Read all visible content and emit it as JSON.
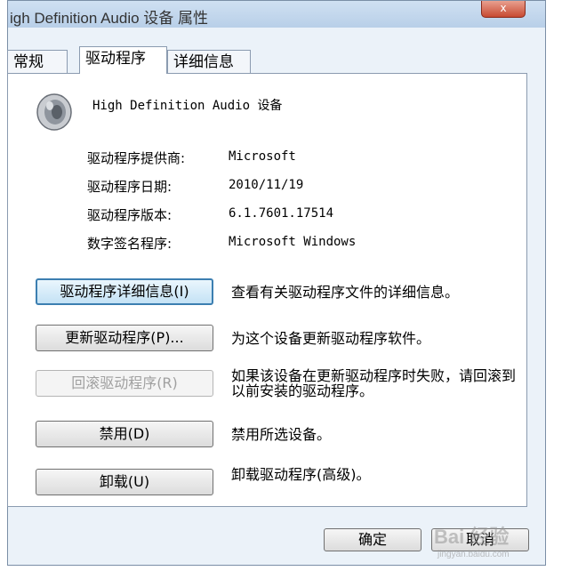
{
  "window": {
    "title": "igh Definition Audio 设备 属性",
    "close_label": "x"
  },
  "tabs": [
    {
      "label": "常规"
    },
    {
      "label": "驱动程序"
    },
    {
      "label": "详细信息"
    }
  ],
  "device": {
    "name": "High Definition Audio 设备",
    "icon": "speaker-icon"
  },
  "info": [
    {
      "label": "驱动程序提供商:",
      "value": "Microsoft"
    },
    {
      "label": "驱动程序日期:",
      "value": "2010/11/19"
    },
    {
      "label": "驱动程序版本:",
      "value": "6.1.7601.17514"
    },
    {
      "label": "数字签名程序:",
      "value": "Microsoft Windows"
    }
  ],
  "actions": [
    {
      "button": "驱动程序详细信息(I)",
      "description": "查看有关驱动程序文件的详细信息。"
    },
    {
      "button": "更新驱动程序(P)...",
      "description": "为这个设备更新驱动程序软件。"
    },
    {
      "button": "回滚驱动程序(R)",
      "description": "如果该设备在更新驱动程序时失败，请回滚到以前安装的驱动程序。"
    },
    {
      "button": "禁用(D)",
      "description": "禁用所选设备。"
    },
    {
      "button": "卸载(U)",
      "description": "卸载驱动程序(高级)。"
    }
  ],
  "footer": {
    "ok_label": "确定",
    "cancel_label": "取消"
  },
  "watermark": {
    "text": "Bai 经验",
    "url": "jingyan.baidu.com"
  }
}
